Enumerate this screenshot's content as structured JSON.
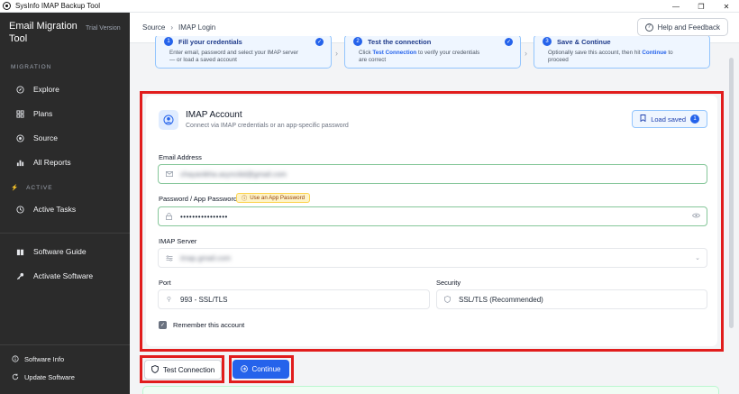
{
  "window": {
    "title": "SysInfo IMAP Backup Tool",
    "controls": [
      "—",
      "❐",
      "✕"
    ]
  },
  "sidebar": {
    "brand": "Email Migration Tool",
    "brand_sub": "Trial Version",
    "migration_label": "MIGRATION",
    "active_label": "ACTIVE",
    "items": [
      {
        "label": "Explore",
        "icon": "compass-icon"
      },
      {
        "label": "Plans",
        "icon": "grid-icon"
      },
      {
        "label": "Source",
        "icon": "target-icon"
      },
      {
        "label": "All Reports",
        "icon": "chart-icon"
      },
      {
        "label": "Active Tasks",
        "icon": "clock-icon"
      },
      {
        "label": "Software Guide",
        "icon": "book-icon"
      },
      {
        "label": "Activate Software",
        "icon": "key-icon"
      },
      {
        "label": "Software Info",
        "icon": "info-icon"
      },
      {
        "label": "Update Software",
        "icon": "refresh-icon"
      }
    ]
  },
  "header": {
    "crumb_parent": "Source",
    "crumb_sep": "›",
    "crumb_current": "IMAP Login",
    "help_label": "Help and Feedback"
  },
  "steps": [
    {
      "num": "1",
      "title": "Fill your credentials",
      "desc1": "Enter email, password and select your IMAP server",
      "desc2": "— or load a saved account"
    },
    {
      "num": "2",
      "title": "Test the connection",
      "desc1_a": "Click ",
      "desc1_b": "Test Connection",
      "desc1_c": " to verify your credentials",
      "desc2": "are correct"
    },
    {
      "num": "3",
      "title": "Save & Continue",
      "desc1_a": "Optionally save this account, then hit ",
      "desc1_b": "Continue",
      "desc1_c": " to",
      "desc2": "proceed"
    }
  ],
  "card": {
    "title": "IMAP Account",
    "subtitle": "Connect via IMAP credentials or an app-specific password",
    "load_saved_label": "Load saved",
    "load_saved_count": "1",
    "email_label": "Email Address",
    "email_value": "chayanikha.asynciiid@gmail.com",
    "password_label": "Password / App Password",
    "app_password_hint": "Use an App Password",
    "password_value": "••••••••••••••••",
    "server_label": "IMAP Server",
    "server_value": "imap.gmail.com",
    "port_label": "Port",
    "port_value": "993 - SSL/TLS",
    "security_label": "Security",
    "security_value": "SSL/TLS (Recommended)",
    "remember_label": "Remember this account"
  },
  "actions": {
    "test_label": "Test Connection",
    "continue_label": "Continue"
  },
  "colors": {
    "accent": "#2563eb",
    "sidebar_bg": "#2b2b2b",
    "highlight": "#e11d1d",
    "valid_border": "#86c79a"
  }
}
